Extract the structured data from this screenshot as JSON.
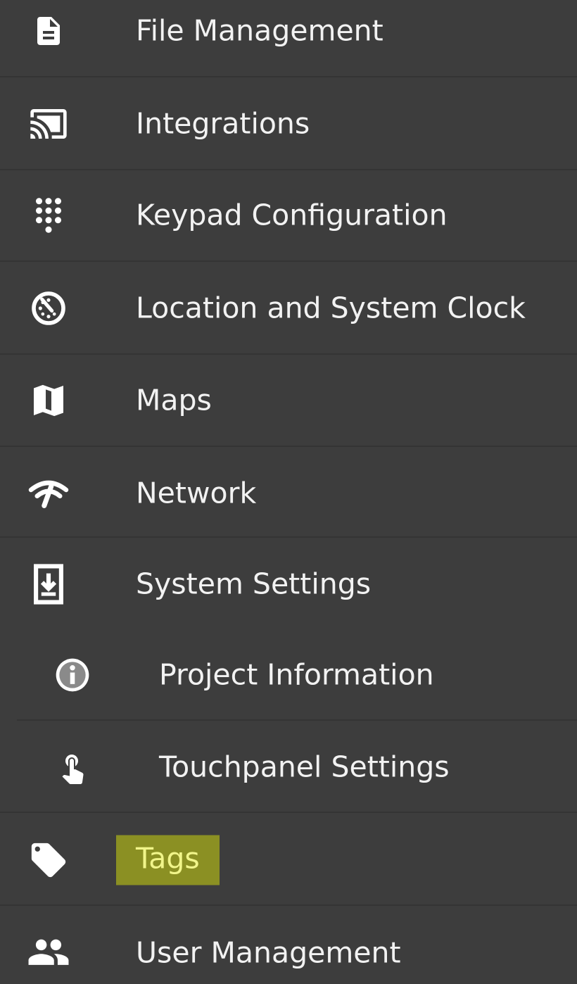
{
  "menu": {
    "items": [
      {
        "label": "File Management",
        "icon": "file-icon"
      },
      {
        "label": "Integrations",
        "icon": "cast-icon"
      },
      {
        "label": "Keypad Configuration",
        "icon": "dialpad-icon"
      },
      {
        "label": "Location and System Clock",
        "icon": "clock-icon"
      },
      {
        "label": "Maps",
        "icon": "map-icon"
      },
      {
        "label": "Network",
        "icon": "network-icon"
      },
      {
        "label": "System Settings",
        "icon": "system-update-icon"
      },
      {
        "label": "Project Information",
        "icon": "info-icon"
      },
      {
        "label": "Touchpanel Settings",
        "icon": "touch-icon"
      },
      {
        "label": "Tags",
        "icon": "tag-icon"
      },
      {
        "label": "User Management",
        "icon": "people-icon"
      }
    ]
  },
  "colors": {
    "background": "#3d3d3d",
    "text": "#f2f2f2",
    "highlight_bg": "#8b9023",
    "highlight_text": "#f1f58a"
  }
}
